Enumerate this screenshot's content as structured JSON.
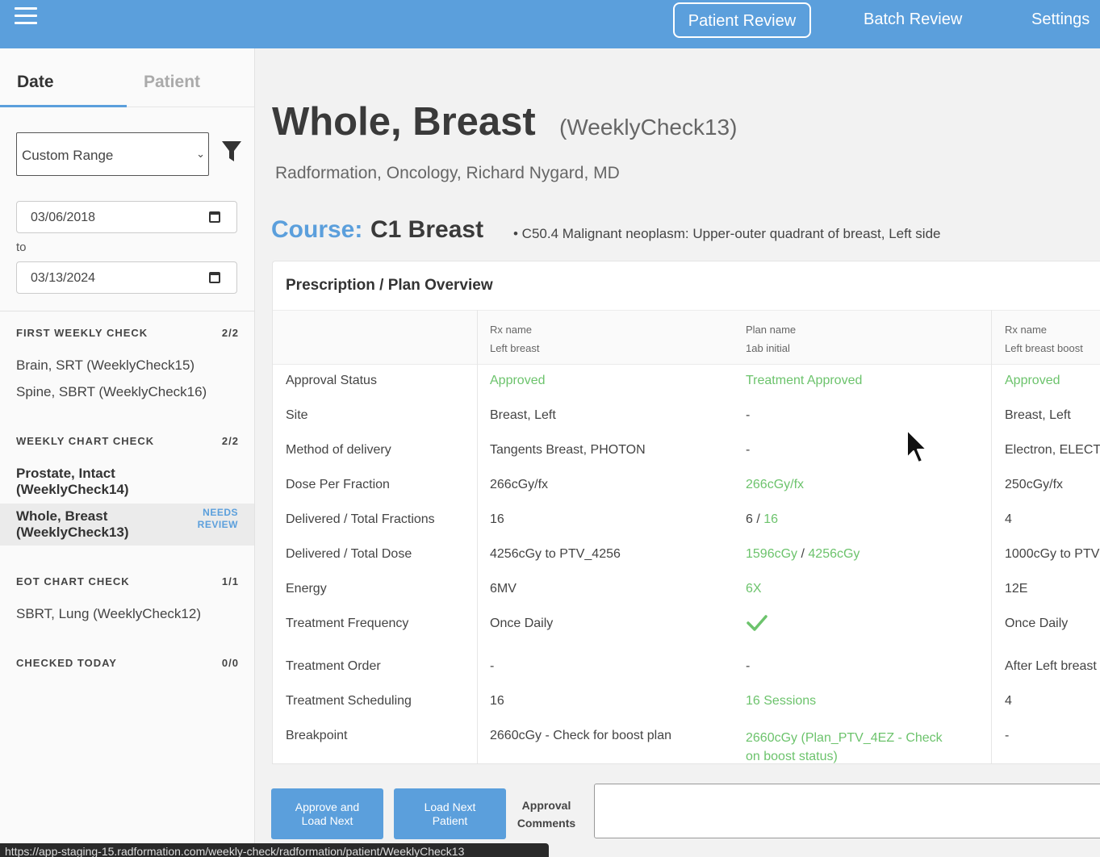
{
  "nav": {
    "active_label": "Patient Review",
    "batch_label": "Batch Review",
    "settings_label": "Settings"
  },
  "sidebar": {
    "tabs": [
      "Date",
      "Patient"
    ],
    "range_select": "Custom Range",
    "date_from": "03/06/2018",
    "to_label": "to",
    "date_to": "03/13/2024",
    "groups": [
      {
        "title": "FIRST WEEKLY CHECK",
        "count": "2/2",
        "items": [
          "Brain, SRT (WeeklyCheck15)",
          "Spine, SBRT (WeeklyCheck16)"
        ]
      },
      {
        "title": "WEEKLY CHART CHECK",
        "count": "2/2",
        "items": [
          "Prostate, Intact\n(WeeklyCheck14)",
          "Whole, Breast\n(WeeklyCheck13)"
        ],
        "badge": "NEEDS\nREVIEW"
      },
      {
        "title": "EOT CHART CHECK",
        "count": "1/1",
        "items": [
          "SBRT, Lung (WeeklyCheck12)"
        ]
      },
      {
        "title": "CHECKED TODAY",
        "count": "0/0",
        "items": []
      }
    ]
  },
  "main": {
    "title": "Whole, Breast",
    "subtitle": "(WeeklyCheck13)",
    "org": "Radformation, Oncology, Richard Nygard, MD",
    "course_label": "Course:",
    "course_name": "C1 Breast",
    "diagnosis": "• C50.4 Malignant neoplasm: Upper-outer quadrant of breast, Left side"
  },
  "table": {
    "title": "Prescription / Plan Overview",
    "columns": [
      {
        "line1": "Rx name",
        "line2": "Left breast"
      },
      {
        "line1": "Plan name",
        "line2": "1ab initial"
      },
      {
        "line1": "Rx name",
        "line2": "Left breast boost"
      }
    ],
    "rows": [
      {
        "label": "Approval Status",
        "c1": "Approved",
        "c2": "Treatment Approved",
        "c3": "Approved"
      },
      {
        "label": "Site",
        "c1": "Breast, Left",
        "c2": "-",
        "c3": "Breast, Left"
      },
      {
        "label": "Method of delivery",
        "c1": "Tangents Breast, PHOTON",
        "c2": "-",
        "c3": "Electron, ELECT"
      },
      {
        "label": "Dose Per Fraction",
        "c1": "266cGy/fx",
        "c2": "266cGy/fx",
        "c3": "250cGy/fx"
      },
      {
        "label": "Delivered / Total Fractions",
        "c1": "16",
        "c2a": "6",
        "c2sep": " / ",
        "c2b": "16",
        "c3": "4"
      },
      {
        "label": "Delivered / Total Dose",
        "c1": "4256cGy to PTV_4256",
        "c2a": "1596cGy",
        "c2sep": " / ",
        "c2b": "4256cGy",
        "c3": "1000cGy to PTV"
      },
      {
        "label": "Energy",
        "c1": "6MV",
        "c2": "6X",
        "c3": "12E"
      },
      {
        "label": "Treatment Frequency",
        "c1": "Once Daily",
        "c2": "check-icon",
        "c3": "Once Daily"
      },
      {
        "label": "Treatment Order",
        "c1": "-",
        "c2": "-",
        "c3": "After Left breast"
      },
      {
        "label": "Treatment Scheduling",
        "c1": "16",
        "c2": "16 Sessions",
        "c3": "4"
      },
      {
        "label": "Breakpoint",
        "c1": "2660cGy - Check for boost plan",
        "c2": "2660cGy (Plan_PTV_4EZ - Check\non boost status)",
        "c3": "-"
      }
    ]
  },
  "footer": {
    "approve_label": "Approve and\nLoad Next",
    "next_label": "Load Next\nPatient",
    "comments_label": "Approval\nComments"
  },
  "status_url": "https://app-staging-15.radformation.com/weekly-check/radformation/patient/WeeklyCheck13",
  "colors": {
    "accent": "#5b9fdc",
    "approved": "#6cc36c"
  }
}
